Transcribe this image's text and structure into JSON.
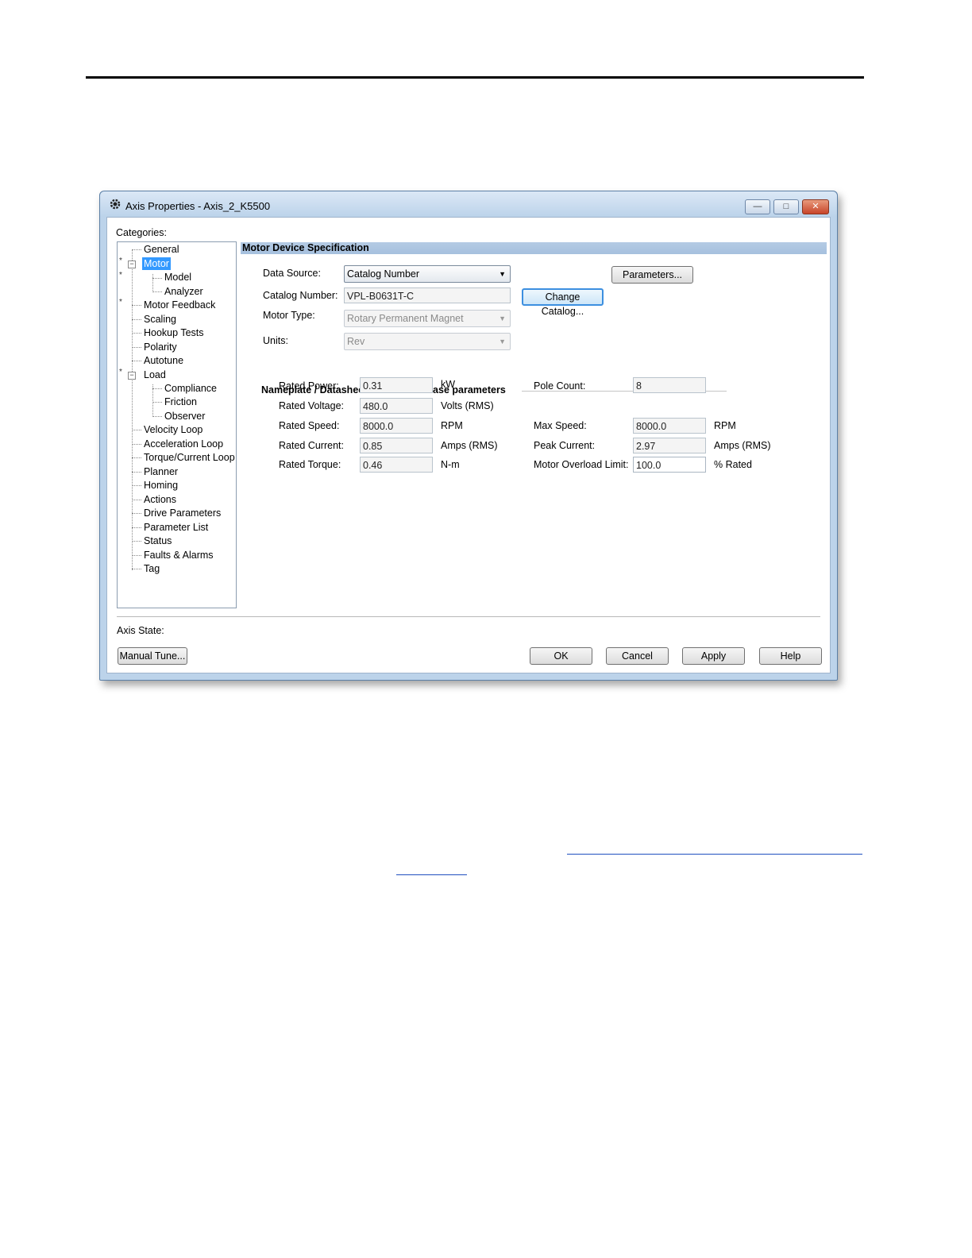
{
  "window": {
    "title": "Axis Properties - Axis_2_K5500",
    "min_glyph": "—",
    "max_glyph": "□",
    "close_glyph": "✕"
  },
  "categories_label": "Categories:",
  "tree": {
    "items": [
      {
        "label": "General",
        "selected": false
      },
      {
        "label": "Motor",
        "selected": true
      },
      {
        "label": "Model",
        "selected": false
      },
      {
        "label": "Analyzer",
        "selected": false
      },
      {
        "label": "Motor Feedback",
        "selected": false
      },
      {
        "label": "Scaling",
        "selected": false
      },
      {
        "label": "Hookup Tests",
        "selected": false
      },
      {
        "label": "Polarity",
        "selected": false
      },
      {
        "label": "Autotune",
        "selected": false
      },
      {
        "label": "Load",
        "selected": false
      },
      {
        "label": "Compliance",
        "selected": false
      },
      {
        "label": "Friction",
        "selected": false
      },
      {
        "label": "Observer",
        "selected": false
      },
      {
        "label": "Velocity Loop",
        "selected": false
      },
      {
        "label": "Acceleration Loop",
        "selected": false
      },
      {
        "label": "Torque/Current Loop",
        "selected": false
      },
      {
        "label": "Planner",
        "selected": false
      },
      {
        "label": "Homing",
        "selected": false
      },
      {
        "label": "Actions",
        "selected": false
      },
      {
        "label": "Drive Parameters",
        "selected": false
      },
      {
        "label": "Parameter List",
        "selected": false
      },
      {
        "label": "Status",
        "selected": false
      },
      {
        "label": "Faults & Alarms",
        "selected": false
      },
      {
        "label": "Tag",
        "selected": false
      }
    ],
    "modified_marker": "*",
    "expander_glyph": "−"
  },
  "section_title": "Motor Device Specification",
  "spec": {
    "data_source_label": "Data Source:",
    "data_source_value": "Catalog Number",
    "catalog_number_label": "Catalog Number:",
    "catalog_number_value": "VPL-B0631T-C",
    "motor_type_label": "Motor Type:",
    "motor_type_value": "Rotary Permanent Magnet",
    "units_label": "Units:",
    "units_value": "Rev",
    "parameters_button": "Parameters...",
    "change_catalog_button": "Change Catalog...",
    "dropdown_arrow": "▼"
  },
  "nameplate": {
    "title": "Nameplate / Datasheet - Phase to Phase parameters",
    "rated_power_label": "Rated Power:",
    "rated_power_value": "0.31",
    "rated_power_unit": "kW",
    "rated_voltage_label": "Rated Voltage:",
    "rated_voltage_value": "480.0",
    "rated_voltage_unit": "Volts (RMS)",
    "rated_speed_label": "Rated Speed:",
    "rated_speed_value": "8000.0",
    "rated_speed_unit": "RPM",
    "rated_current_label": "Rated Current:",
    "rated_current_value": "0.85",
    "rated_current_unit": "Amps (RMS)",
    "rated_torque_label": "Rated Torque:",
    "rated_torque_value": "0.46",
    "rated_torque_unit": "N-m",
    "pole_count_label": "Pole Count:",
    "pole_count_value": "8",
    "max_speed_label": "Max Speed:",
    "max_speed_value": "8000.0",
    "max_speed_unit": "RPM",
    "peak_current_label": "Peak Current:",
    "peak_current_value": "2.97",
    "peak_current_unit": "Amps (RMS)",
    "overload_label": "Motor Overload Limit:",
    "overload_value": "100.0",
    "overload_unit": "% Rated"
  },
  "footer": {
    "axis_state_label": "Axis State:",
    "manual_tune_button": "Manual Tune...",
    "ok_button": "OK",
    "cancel_button": "Cancel",
    "apply_button": "Apply",
    "help_button": "Help"
  }
}
